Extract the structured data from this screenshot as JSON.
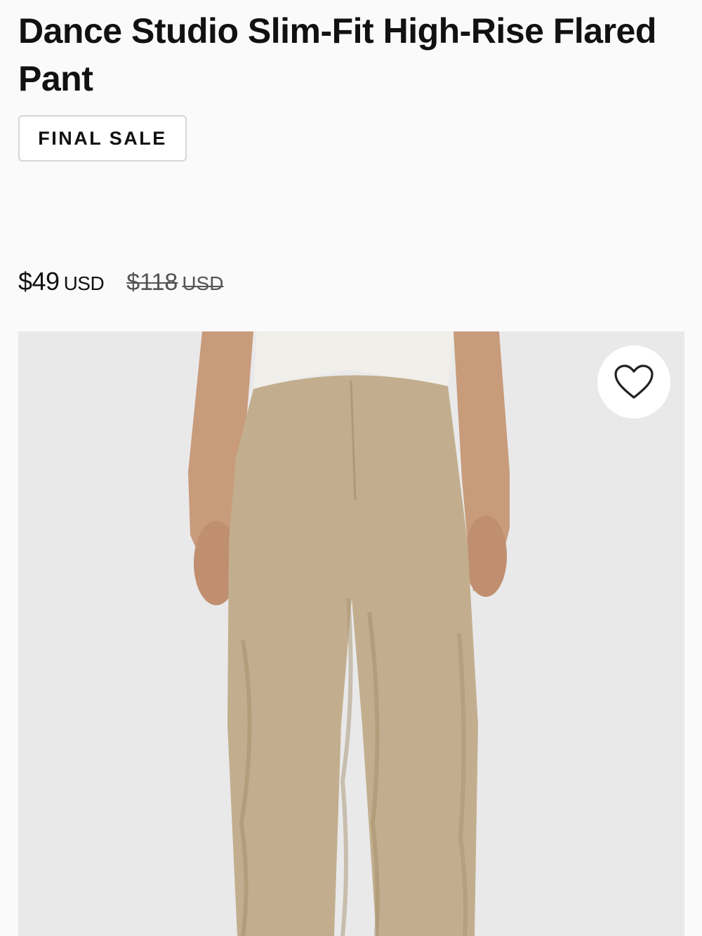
{
  "product": {
    "title": "Dance Studio Slim-Fit High-Rise Flared Pant",
    "badge": "FINAL SALE",
    "price": {
      "current": "$49",
      "current_currency": "USD",
      "original": "$118",
      "original_currency": "USD"
    }
  },
  "image": {
    "subject": "model wearing khaki ruched pants",
    "pant_color": "#c2ae8e",
    "top_color": "#f1efea",
    "skin_color": "#c89b7b",
    "background_color": "#e9e9ea"
  },
  "wishlist": {
    "icon": "heart-icon"
  }
}
